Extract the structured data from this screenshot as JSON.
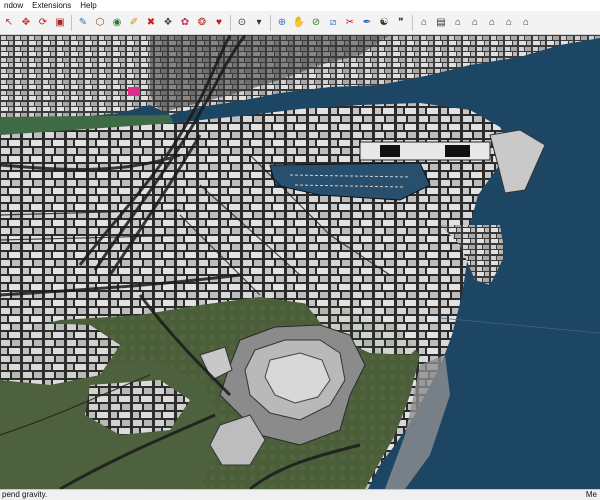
{
  "menu": {
    "items": [
      "ndow",
      "Extensions",
      "Help"
    ]
  },
  "toolbar": {
    "groups": [
      [
        {
          "icon": "select-icon",
          "glyph": "↖",
          "color": "#d62020"
        },
        {
          "icon": "move-icon",
          "glyph": "✥",
          "color": "#d62020"
        },
        {
          "icon": "rotate-icon",
          "glyph": "⟳",
          "color": "#c01818"
        },
        {
          "icon": "scale-icon",
          "glyph": "▣",
          "color": "#b02020"
        }
      ],
      [
        {
          "icon": "pushpull-icon",
          "glyph": "✎",
          "color": "#3a6ec6"
        },
        {
          "icon": "offset-icon",
          "glyph": "⬡",
          "color": "#7a5a20"
        },
        {
          "icon": "paint-bucket-icon",
          "glyph": "◉",
          "color": "#2f7a2f"
        },
        {
          "icon": "eraser-icon",
          "glyph": "✐",
          "color": "#d08a10"
        },
        {
          "icon": "close-x-icon",
          "glyph": "✖",
          "color": "#c71c1c"
        },
        {
          "icon": "components-icon",
          "glyph": "❖",
          "color": "#444"
        },
        {
          "icon": "materials-icon",
          "glyph": "✿",
          "color": "#c02d6a"
        },
        {
          "icon": "styles-icon",
          "glyph": "❂",
          "color": "#b0322a"
        },
        {
          "icon": "layers-icon",
          "glyph": "♥",
          "color": "#c01a1a"
        }
      ],
      [
        {
          "icon": "zoom-extents-icon",
          "glyph": "⊙",
          "color": "#333"
        },
        {
          "icon": "chevron-down-icon",
          "glyph": "▾",
          "color": "#333"
        }
      ],
      [
        {
          "icon": "position-camera-icon",
          "glyph": "⊕",
          "color": "#3a6ec6"
        },
        {
          "icon": "look-around-icon",
          "glyph": "✋",
          "color": "#d08a10"
        },
        {
          "icon": "walk-icon",
          "glyph": "⊘",
          "color": "#2f7a2f"
        },
        {
          "icon": "section-plane-icon",
          "glyph": "⧄",
          "color": "#3a6ec6"
        },
        {
          "icon": "tape-icon",
          "glyph": "✂",
          "color": "#c71c1c"
        },
        {
          "icon": "protractor-icon",
          "glyph": "✒",
          "color": "#2a5fb8"
        },
        {
          "icon": "walkthrough-icon",
          "glyph": "☯",
          "color": "#333"
        },
        {
          "icon": "footprints-icon",
          "glyph": "❞",
          "color": "#333"
        }
      ],
      [
        {
          "icon": "iso-view-icon",
          "glyph": "⌂",
          "color": "#333"
        },
        {
          "icon": "save-icon",
          "glyph": "▤",
          "color": "#333"
        },
        {
          "icon": "top-view-icon",
          "glyph": "⌂",
          "color": "#333"
        },
        {
          "icon": "front-view-icon",
          "glyph": "⌂",
          "color": "#333"
        },
        {
          "icon": "right-view-icon",
          "glyph": "⌂",
          "color": "#333"
        },
        {
          "icon": "back-view-icon",
          "glyph": "⌂",
          "color": "#333"
        },
        {
          "icon": "left-view-icon",
          "glyph": "⌂",
          "color": "#333"
        }
      ]
    ]
  },
  "status": {
    "left": "pend gravity.",
    "right": "Me"
  },
  "colors": {
    "water": "#1d4665",
    "terrain": "#4a5d3a",
    "building": "#d4d4d4",
    "road": "#2a2a2a"
  }
}
